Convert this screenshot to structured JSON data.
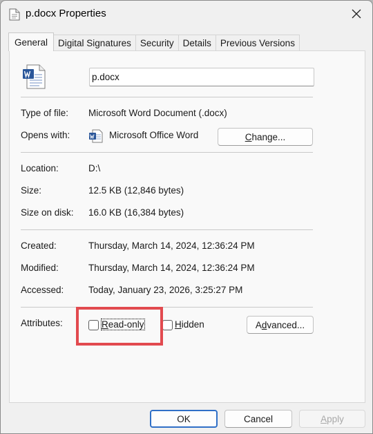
{
  "window": {
    "title": "p.docx Properties",
    "close_icon": "close-icon"
  },
  "tabs": [
    {
      "label": "General",
      "active": true
    },
    {
      "label": "Digital Signatures",
      "active": false
    },
    {
      "label": "Security",
      "active": false
    },
    {
      "label": "Details",
      "active": false
    },
    {
      "label": "Previous Versions",
      "active": false
    }
  ],
  "general": {
    "file_name": "p.docx",
    "type_of_file_label": "Type of file:",
    "type_of_file": "Microsoft Word Document (.docx)",
    "opens_with_label": "Opens with:",
    "opens_with": "Microsoft Office Word",
    "change_button_prefix": "",
    "change_button_mnemonic": "C",
    "change_button_rest": "hange...",
    "location_label": "Location:",
    "location": "D:\\",
    "size_label": "Size:",
    "size": "12.5 KB (12,846 bytes)",
    "size_on_disk_label": "Size on disk:",
    "size_on_disk": "16.0 KB (16,384 bytes)",
    "created_label": "Created:",
    "created": "Thursday, March 14, 2024, 12:36:24 PM",
    "modified_label": "Modified:",
    "modified": "Thursday, March 14, 2024, 12:36:24 PM",
    "accessed_label": "Accessed:",
    "accessed": "Today, January 23, 2026, 3:25:27 PM",
    "attributes_label": "Attributes:",
    "readonly_mnemonic": "R",
    "readonly_rest": "ead-only",
    "readonly_checked": false,
    "hidden_mnemonic": "H",
    "hidden_rest": "idden",
    "hidden_checked": false,
    "advanced_mnemonic": "d",
    "advanced_prefix": "A",
    "advanced_rest": "vanced..."
  },
  "footer": {
    "ok_label": "OK",
    "cancel_label": "Cancel",
    "apply_mnemonic": "A",
    "apply_rest": "pply"
  },
  "colors": {
    "highlight_box": "#e24a4f",
    "primary_button_border": "#2f6fc7",
    "word_blue": "#2b579a"
  }
}
